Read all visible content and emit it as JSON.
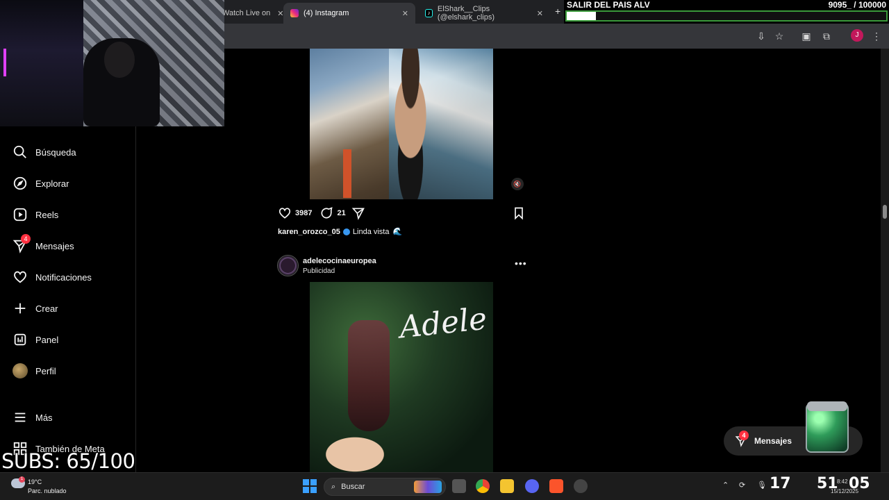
{
  "browser": {
    "tabs": [
      {
        "title": "Watch Live on",
        "active": false
      },
      {
        "title": "(4) Instagram",
        "active": true
      },
      {
        "title": "ElShark__Clips (@elshark_clips)",
        "active": false
      }
    ],
    "new_tab": "+"
  },
  "goal": {
    "title": "SALIR DEL PAIS ALV",
    "count": "9095_ / 100000",
    "progress_fraction": 0.09095
  },
  "sidebar": {
    "items": [
      {
        "label": "Búsqueda",
        "icon": "search-icon"
      },
      {
        "label": "Explorar",
        "icon": "compass-icon"
      },
      {
        "label": "Reels",
        "icon": "reels-icon"
      },
      {
        "label": "Mensajes",
        "icon": "messenger-icon",
        "badge": "4"
      },
      {
        "label": "Notificaciones",
        "icon": "heart-icon"
      },
      {
        "label": "Crear",
        "icon": "plus-icon"
      },
      {
        "label": "Panel",
        "icon": "chart-icon"
      },
      {
        "label": "Perfil",
        "icon": "profile-avatar"
      },
      {
        "label": "Más",
        "icon": "menu-icon"
      },
      {
        "label": "También de Meta",
        "icon": "meta-grid-icon"
      }
    ]
  },
  "overlay": {
    "subs": "SUBS: 65/100"
  },
  "feed": {
    "post1": {
      "likes": "3987",
      "comments": "21",
      "username": "karen_orozco_05",
      "caption": "Linda vista",
      "caption_emoji": "🌊"
    },
    "post2": {
      "username": "adelecocinaeuropea",
      "subtitle": "Publicidad",
      "more": "•••",
      "image_script_text": "Adele"
    }
  },
  "messages_pill": {
    "label": "Mensajes",
    "badge": "4"
  },
  "taskbar": {
    "weather_temp": "19°C",
    "weather_desc": "Parc. nublado",
    "weather_badge": "1",
    "search_placeholder": "Buscar",
    "clock_hours": "17",
    "clock_minutes": "51",
    "clock_seconds": "05",
    "time": "8:42",
    "date": "15/12/2025"
  },
  "colors": {
    "accent_badge": "#ff3040",
    "verified": "#3897f0",
    "goal_border": "#3a9a3a"
  }
}
